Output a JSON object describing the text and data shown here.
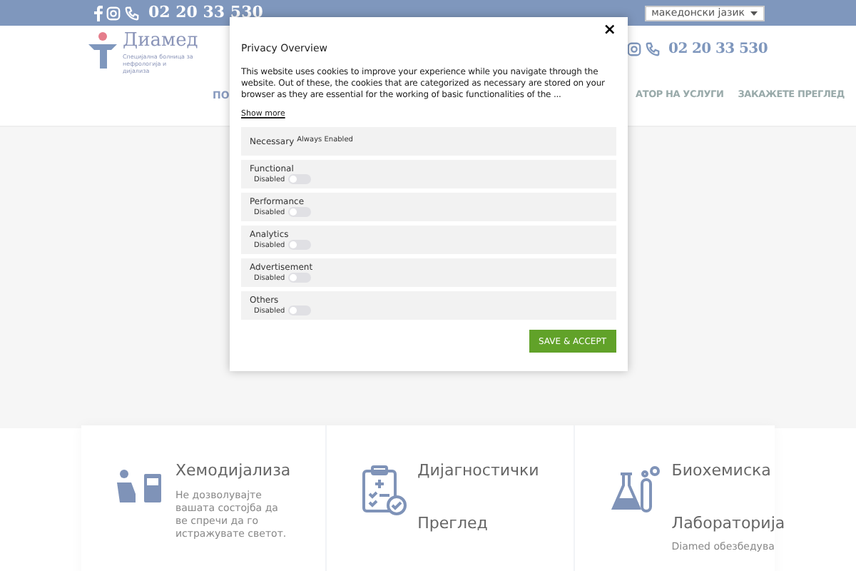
{
  "top_bar": {
    "phone": "02 20 33 530",
    "language": "македонски јазик"
  },
  "header": {
    "logo_name": "Диамед",
    "logo_tagline": "Специјална болница за нефрологија и дијализа",
    "phone": "02 20 33 530"
  },
  "nav": [
    {
      "label": "ПО"
    },
    {
      "label": "АТОР НА УСЛУГИ"
    },
    {
      "label": "ЗАКАЖЕТЕ ПРЕГЛЕД"
    }
  ],
  "services": [
    {
      "kind": "dialysis",
      "title": "Хемодијализа",
      "text": "Не дозволувајте вашата состојба да ве спречи да го истражувате светот."
    },
    {
      "kind": "diagnostics",
      "title": "Дијагностички",
      "title_2": "Преглед"
    },
    {
      "kind": "lab",
      "title": "Биохемиска",
      "title_2": "Лабораторија",
      "text": "Diamed обезбедува"
    }
  ],
  "modal": {
    "title": "Privacy Overview",
    "body": "This website uses cookies to improve your experience while you navigate through the website. Out of these, the cookies that are categorized as necessary are stored on your browser as they are essential for the working of basic functionalities of the ...",
    "show_more": "Show more",
    "close": "×",
    "categories": [
      {
        "kind": "fixed",
        "name": "Necessary",
        "status": "Always Enabled"
      },
      {
        "kind": "toggle",
        "name": "Functional",
        "status": "Disabled",
        "on": false
      },
      {
        "kind": "toggle",
        "name": "Performance",
        "status": "Disabled",
        "on": false
      },
      {
        "kind": "toggle",
        "name": "Analytics",
        "status": "Disabled",
        "on": false
      },
      {
        "kind": "toggle",
        "name": "Advertisement",
        "status": "Disabled",
        "on": false
      },
      {
        "kind": "toggle",
        "name": "Others",
        "status": "Disabled",
        "on": false
      }
    ],
    "accept": "SAVE & ACCEPT"
  }
}
